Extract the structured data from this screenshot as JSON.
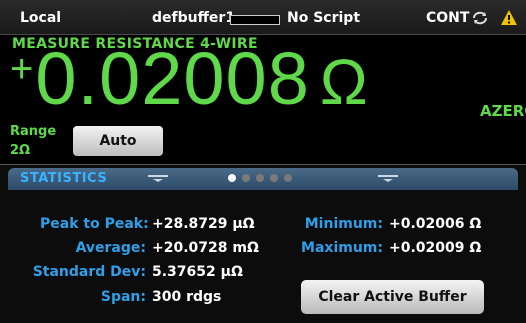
{
  "status": {
    "mode": "Local",
    "buffer": "defbuffer1",
    "script": "No Script",
    "trigger": "CONT",
    "sync_icon": "sync-icon",
    "warning_icon": "warning-icon"
  },
  "measure": {
    "function": "MEASURE RESISTANCE 4-WIRE",
    "sign": "+",
    "value": "0.02008",
    "unit": "Ω",
    "azero": "AZERO",
    "range_label": "Range",
    "range_value": "2Ω",
    "range_button": "Auto"
  },
  "panel": {
    "title": "STATISTICS",
    "page_count": 5,
    "active_page": 1
  },
  "stats": {
    "peak_label": "Peak to Peak:",
    "peak_value": "+28.8729 µΩ",
    "average_label": "Average:",
    "average_value": "+20.0728 mΩ",
    "stddev_label": "Standard Dev:",
    "stddev_value": "5.37652 µΩ",
    "span_label": "Span:",
    "span_value": "300 rdgs",
    "min_label": "Minimum:",
    "min_value": "+0.02006 Ω",
    "max_label": "Maximum:",
    "max_value": "+0.02009 Ω"
  },
  "buttons": {
    "clear_buffer": "Clear Active Buffer"
  },
  "colors": {
    "reading": "#5fd94a",
    "label": "#2e9fe8",
    "tab_title": "#37b4ff",
    "warning": "#f2c300"
  }
}
